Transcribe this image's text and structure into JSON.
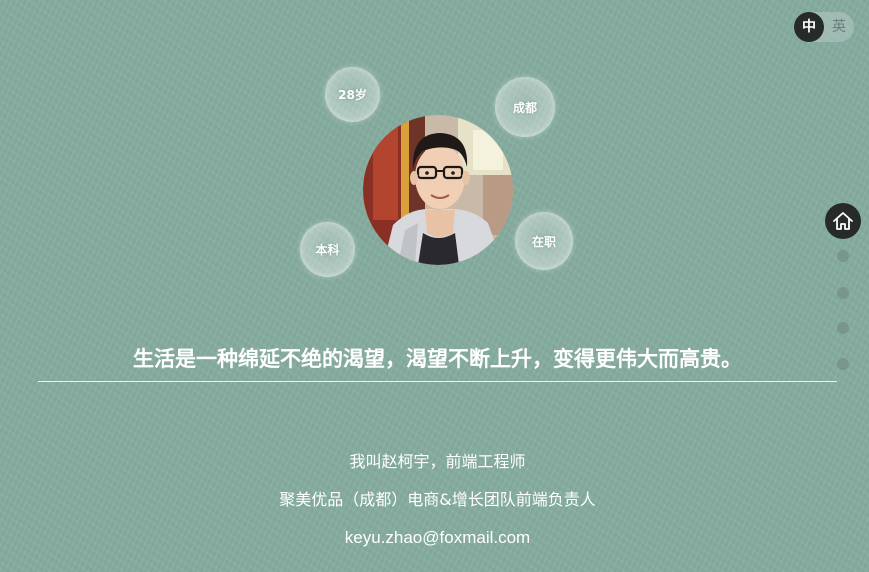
{
  "language_toggle": {
    "active": "中",
    "inactive": "英"
  },
  "profile": {
    "tags": {
      "age": "28岁",
      "city": "成都",
      "degree": "本科",
      "status": "在职"
    }
  },
  "side_nav": {
    "home_icon": "home-icon",
    "dot_count": 4
  },
  "motto": "生活是一种绵延不绝的渴望，渴望不断上升，变得更伟大而高贵。",
  "intro": {
    "name_line": "我叫赵柯宇，前端工程师",
    "role_line": "聚美优品（成都）电商&增长团队前端负责人",
    "email": "keyu.zhao@foxmail.com"
  },
  "colors": {
    "background": "#86aca0",
    "dark": "#262a29",
    "text": "#ffffff"
  }
}
